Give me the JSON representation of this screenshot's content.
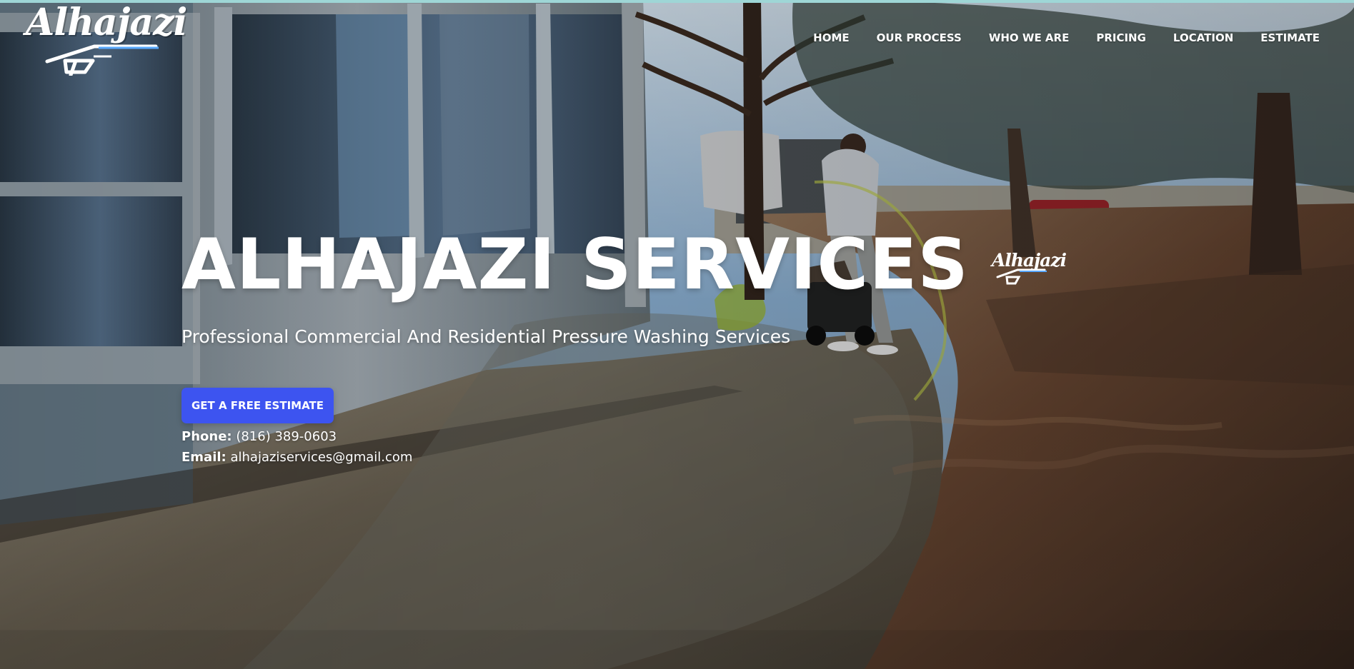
{
  "brand": {
    "logo_text": "Alhajazi",
    "mini_logo_text": "Alhajazi"
  },
  "navigation": {
    "items": [
      {
        "label": "HOME"
      },
      {
        "label": "OUR PROCESS"
      },
      {
        "label": "WHO WE ARE"
      },
      {
        "label": "PRICING"
      },
      {
        "label": "LOCATION"
      },
      {
        "label": "ESTIMATE"
      }
    ]
  },
  "hero": {
    "title": "ALHAJAZI SERVICES",
    "subtitle": "Professional Commercial And Residential Pressure Washing Services",
    "cta_label": "GET A FREE ESTIMATE",
    "phone_label": "Phone:",
    "phone_value": "(816) 389-0603",
    "email_label": "Email:",
    "email_value": "alhajaziservices@gmail.com"
  },
  "icons": {
    "logo": "pressure-washer-gun-icon"
  },
  "colors": {
    "accent": "#3d54f0",
    "top_line": "#9ed6d6",
    "text": "#ffffff"
  }
}
